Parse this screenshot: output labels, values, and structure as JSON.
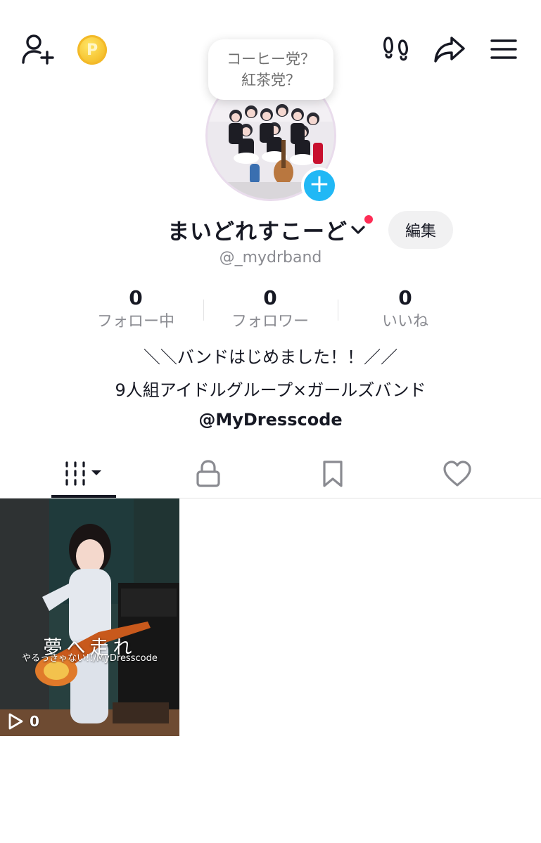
{
  "topbar": {
    "add_friend_icon": "person-plus-icon",
    "coin_icon": "coin-icon",
    "coin_letter": "P",
    "footprints_icon": "footprints-icon",
    "share_icon": "share-arrow-icon",
    "menu_icon": "hamburger-menu-icon"
  },
  "bubble": {
    "line1": "コーヒー党？",
    "line2": "紅茶党？"
  },
  "profile": {
    "name": "まいどれすこーど",
    "edit_label": "編集",
    "handle": "@_mydrband"
  },
  "stats": {
    "following_count": "0",
    "following_label": "フォロー中",
    "followers_count": "0",
    "followers_label": "フォロワー",
    "likes_count": "0",
    "likes_label": "いいね"
  },
  "bio": {
    "line1": "＼＼バンドはじめました！！／／",
    "line2": "9人組アイドルグループ×ガールズバンド",
    "line3": "@MyDresscode"
  },
  "tabs": [
    {
      "name": "videos",
      "icon": "grid-bars-icon"
    },
    {
      "name": "private",
      "icon": "lock-icon"
    },
    {
      "name": "saved",
      "icon": "bookmark-icon"
    },
    {
      "name": "liked",
      "icon": "heart-icon"
    }
  ],
  "videos": [
    {
      "title": "夢へ走れ",
      "subtitle": "やるっきゃない!!/MyDresscode",
      "views": "0"
    }
  ],
  "colors": {
    "accent_red": "#fe2c55",
    "plus_blue": "#21b8f5",
    "text_primary": "#161823",
    "text_secondary": "#8a8b91"
  }
}
